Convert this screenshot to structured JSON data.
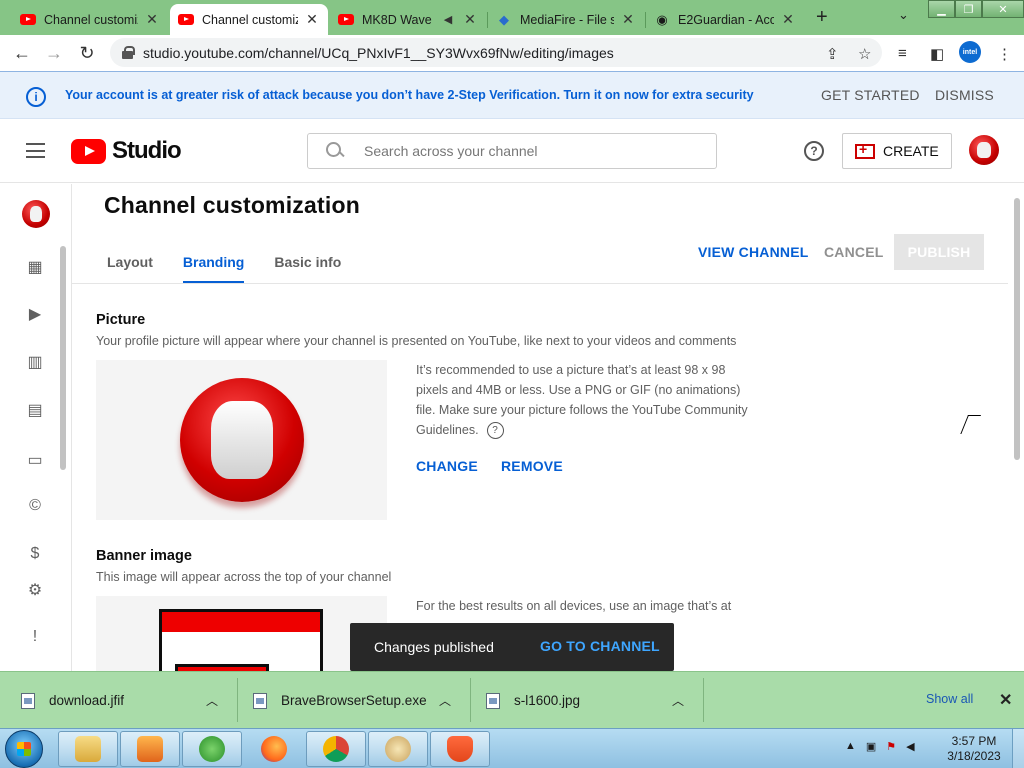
{
  "browser": {
    "tabs": [
      {
        "title": "Channel customiz",
        "favicon": "youtube-icon",
        "active": false
      },
      {
        "title": "Channel customiz",
        "favicon": "youtube-icon",
        "active": true
      },
      {
        "title": "MK8D Wave",
        "favicon": "youtube-icon",
        "active": false
      },
      {
        "title": "MediaFire - File sl",
        "favicon": "mediafire-icon",
        "active": false
      },
      {
        "title": "E2Guardian - Acc",
        "favicon": "globe-icon",
        "active": false
      }
    ],
    "url": "studio.youtube.com/channel/UCq_PNxIvF1__SY3Wvx69fNw/editing/images",
    "intel_badge": "intel"
  },
  "security_banner": {
    "message": "Your account is at greater risk of attack because you don’t have 2-Step Verification. Turn it on now for extra security",
    "get_started": "GET STARTED",
    "dismiss": "DISMISS"
  },
  "header": {
    "logo_text": "Studio",
    "search_placeholder": "Search across your channel",
    "create_label": "CREATE"
  },
  "page": {
    "title": "Channel customization",
    "tabs": [
      {
        "label": "Layout",
        "active": false
      },
      {
        "label": "Branding",
        "active": true
      },
      {
        "label": "Basic info",
        "active": false
      }
    ],
    "view_channel": "VIEW CHANNEL",
    "cancel": "CANCEL",
    "publish": "PUBLISH"
  },
  "picture": {
    "title": "Picture",
    "description": "Your profile picture will appear where your channel is presented on YouTube, like next to your videos and comments",
    "info": "It’s recommended to use a picture that’s at least 98 x 98 pixels and 4MB or less. Use a PNG or GIF (no animations) file. Make sure your picture follows the YouTube Community Guidelines.",
    "change": "CHANGE",
    "remove": "REMOVE"
  },
  "banner_image": {
    "title": "Banner image",
    "description": "This image will appear across the top of your channel",
    "info": "For the best results on all devices, use an image that’s at"
  },
  "snackbar": {
    "message": "Changes published",
    "action": "GO TO CHANNEL"
  },
  "downloads": {
    "items": [
      {
        "name": "download.jfif"
      },
      {
        "name": "BraveBrowserSetup.exe"
      },
      {
        "name": "s-l1600.jpg"
      }
    ],
    "show_all": "Show all"
  },
  "taskbar": {
    "time": "3:57 PM",
    "date": "3/18/2023"
  },
  "colors": {
    "brand_red": "#ff0000",
    "link_blue": "#065fd4",
    "tabstrip_green": "#86c586",
    "shelf_green": "#a9dca9"
  }
}
